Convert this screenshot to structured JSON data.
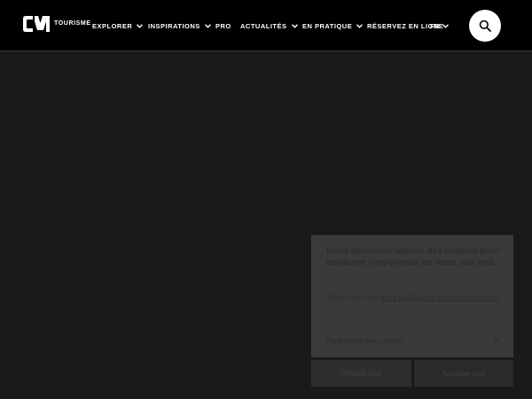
{
  "brand": {
    "logo_text": "CM",
    "name": "TOURISME"
  },
  "nav": {
    "items": [
      {
        "label": "EXPLORER",
        "has_dropdown": true
      },
      {
        "label": "INSPIRATIONS",
        "has_dropdown": true
      },
      {
        "label": "PRO",
        "has_dropdown": false
      },
      {
        "label": "ACTUALITÉS",
        "has_dropdown": true
      },
      {
        "label": "EN PRATIQUE",
        "has_dropdown": true
      },
      {
        "label": "RÉSERVEZ EN LIGNE",
        "has_dropdown": false
      }
    ],
    "language": "FR"
  },
  "search": {
    "icon": "search-icon"
  },
  "cookie_banner": {
    "title": "Nous aimerions utiliser des cookies pour améliorer l'expérience de notre site web.",
    "description_prefix": "Trouvez plus sur",
    "policy_link": "notre politique de gestion des cookies",
    "period": ".",
    "params_label": "Paramètres mes cookies",
    "params_icon": "chevron-right-icon",
    "refuse_label": "Refuser tout",
    "accept_label": "Accepter tout"
  },
  "colors": {
    "header_bg": "#000000",
    "page_bg": "#1a1a1a",
    "search_button": "#ffffff"
  }
}
